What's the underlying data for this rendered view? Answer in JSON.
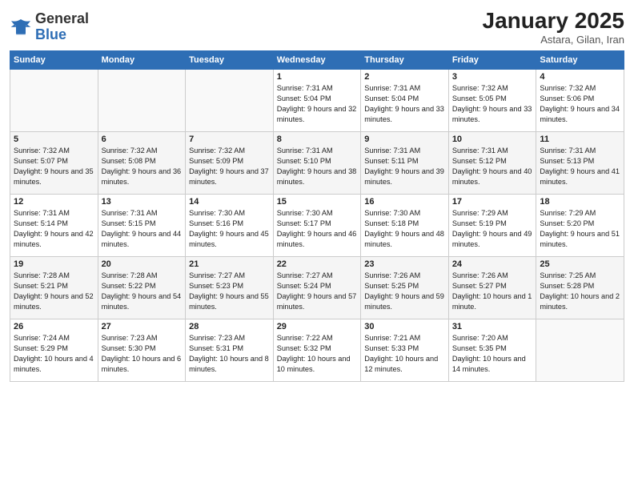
{
  "header": {
    "logo_general": "General",
    "logo_blue": "Blue",
    "month": "January 2025",
    "location": "Astara, Gilan, Iran"
  },
  "days_of_week": [
    "Sunday",
    "Monday",
    "Tuesday",
    "Wednesday",
    "Thursday",
    "Friday",
    "Saturday"
  ],
  "weeks": [
    [
      {
        "day": "",
        "content": ""
      },
      {
        "day": "",
        "content": ""
      },
      {
        "day": "",
        "content": ""
      },
      {
        "day": "1",
        "content": "Sunrise: 7:31 AM\nSunset: 5:04 PM\nDaylight: 9 hours and 32 minutes."
      },
      {
        "day": "2",
        "content": "Sunrise: 7:31 AM\nSunset: 5:04 PM\nDaylight: 9 hours and 33 minutes."
      },
      {
        "day": "3",
        "content": "Sunrise: 7:32 AM\nSunset: 5:05 PM\nDaylight: 9 hours and 33 minutes."
      },
      {
        "day": "4",
        "content": "Sunrise: 7:32 AM\nSunset: 5:06 PM\nDaylight: 9 hours and 34 minutes."
      }
    ],
    [
      {
        "day": "5",
        "content": "Sunrise: 7:32 AM\nSunset: 5:07 PM\nDaylight: 9 hours and 35 minutes."
      },
      {
        "day": "6",
        "content": "Sunrise: 7:32 AM\nSunset: 5:08 PM\nDaylight: 9 hours and 36 minutes."
      },
      {
        "day": "7",
        "content": "Sunrise: 7:32 AM\nSunset: 5:09 PM\nDaylight: 9 hours and 37 minutes."
      },
      {
        "day": "8",
        "content": "Sunrise: 7:31 AM\nSunset: 5:10 PM\nDaylight: 9 hours and 38 minutes."
      },
      {
        "day": "9",
        "content": "Sunrise: 7:31 AM\nSunset: 5:11 PM\nDaylight: 9 hours and 39 minutes."
      },
      {
        "day": "10",
        "content": "Sunrise: 7:31 AM\nSunset: 5:12 PM\nDaylight: 9 hours and 40 minutes."
      },
      {
        "day": "11",
        "content": "Sunrise: 7:31 AM\nSunset: 5:13 PM\nDaylight: 9 hours and 41 minutes."
      }
    ],
    [
      {
        "day": "12",
        "content": "Sunrise: 7:31 AM\nSunset: 5:14 PM\nDaylight: 9 hours and 42 minutes."
      },
      {
        "day": "13",
        "content": "Sunrise: 7:31 AM\nSunset: 5:15 PM\nDaylight: 9 hours and 44 minutes."
      },
      {
        "day": "14",
        "content": "Sunrise: 7:30 AM\nSunset: 5:16 PM\nDaylight: 9 hours and 45 minutes."
      },
      {
        "day": "15",
        "content": "Sunrise: 7:30 AM\nSunset: 5:17 PM\nDaylight: 9 hours and 46 minutes."
      },
      {
        "day": "16",
        "content": "Sunrise: 7:30 AM\nSunset: 5:18 PM\nDaylight: 9 hours and 48 minutes."
      },
      {
        "day": "17",
        "content": "Sunrise: 7:29 AM\nSunset: 5:19 PM\nDaylight: 9 hours and 49 minutes."
      },
      {
        "day": "18",
        "content": "Sunrise: 7:29 AM\nSunset: 5:20 PM\nDaylight: 9 hours and 51 minutes."
      }
    ],
    [
      {
        "day": "19",
        "content": "Sunrise: 7:28 AM\nSunset: 5:21 PM\nDaylight: 9 hours and 52 minutes."
      },
      {
        "day": "20",
        "content": "Sunrise: 7:28 AM\nSunset: 5:22 PM\nDaylight: 9 hours and 54 minutes."
      },
      {
        "day": "21",
        "content": "Sunrise: 7:27 AM\nSunset: 5:23 PM\nDaylight: 9 hours and 55 minutes."
      },
      {
        "day": "22",
        "content": "Sunrise: 7:27 AM\nSunset: 5:24 PM\nDaylight: 9 hours and 57 minutes."
      },
      {
        "day": "23",
        "content": "Sunrise: 7:26 AM\nSunset: 5:25 PM\nDaylight: 9 hours and 59 minutes."
      },
      {
        "day": "24",
        "content": "Sunrise: 7:26 AM\nSunset: 5:27 PM\nDaylight: 10 hours and 1 minute."
      },
      {
        "day": "25",
        "content": "Sunrise: 7:25 AM\nSunset: 5:28 PM\nDaylight: 10 hours and 2 minutes."
      }
    ],
    [
      {
        "day": "26",
        "content": "Sunrise: 7:24 AM\nSunset: 5:29 PM\nDaylight: 10 hours and 4 minutes."
      },
      {
        "day": "27",
        "content": "Sunrise: 7:23 AM\nSunset: 5:30 PM\nDaylight: 10 hours and 6 minutes."
      },
      {
        "day": "28",
        "content": "Sunrise: 7:23 AM\nSunset: 5:31 PM\nDaylight: 10 hours and 8 minutes."
      },
      {
        "day": "29",
        "content": "Sunrise: 7:22 AM\nSunset: 5:32 PM\nDaylight: 10 hours and 10 minutes."
      },
      {
        "day": "30",
        "content": "Sunrise: 7:21 AM\nSunset: 5:33 PM\nDaylight: 10 hours and 12 minutes."
      },
      {
        "day": "31",
        "content": "Sunrise: 7:20 AM\nSunset: 5:35 PM\nDaylight: 10 hours and 14 minutes."
      },
      {
        "day": "",
        "content": ""
      }
    ]
  ]
}
